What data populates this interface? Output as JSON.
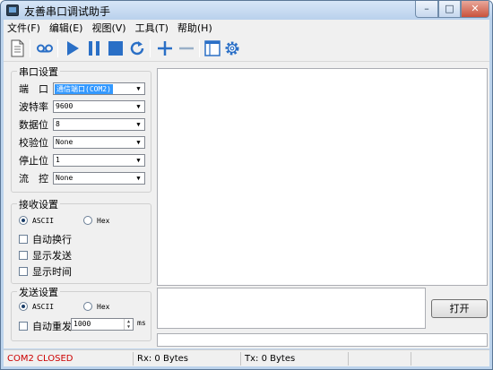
{
  "window": {
    "title": "友善串口调试助手",
    "controls": {
      "minimize": "–",
      "maximize": "□",
      "close": "✕"
    }
  },
  "menu": [
    "文件(F)",
    "编辑(E)",
    "视图(V)",
    "工具(T)",
    "帮助(H)"
  ],
  "toolbar": {
    "icons": [
      "new-document-icon",
      "record-icon",
      "play-icon",
      "pause-icon",
      "stop-icon",
      "refresh-icon",
      "add-icon",
      "remove-icon",
      "window-icon",
      "gear-icon"
    ],
    "colors": {
      "accent": "#2a6fc6",
      "disabled": "#9ab0c8"
    }
  },
  "serial_settings": {
    "title": "串口设置",
    "fields": [
      {
        "label": "端　口",
        "value": "通信端口(COM2)"
      },
      {
        "label": "波特率",
        "value": "9600"
      },
      {
        "label": "数据位",
        "value": "8"
      },
      {
        "label": "校验位",
        "value": "None"
      },
      {
        "label": "停止位",
        "value": "1"
      },
      {
        "label": "流　控",
        "value": "None"
      }
    ]
  },
  "receive_settings": {
    "title": "接收设置",
    "radio_ascii": "ASCII",
    "radio_hex": "Hex",
    "options": [
      "自动换行",
      "显示发送",
      "显示时间"
    ]
  },
  "send_settings": {
    "title": "发送设置",
    "radio_ascii": "ASCII",
    "radio_hex": "Hex",
    "auto_resend": "自动重发",
    "interval": "1000",
    "unit": "ms"
  },
  "open_button": "打开",
  "status": {
    "port": "COM2 CLOSED",
    "rx": "Rx: 0 Bytes",
    "tx": "Tx: 0 Bytes",
    "port_color": "#cc0000"
  }
}
